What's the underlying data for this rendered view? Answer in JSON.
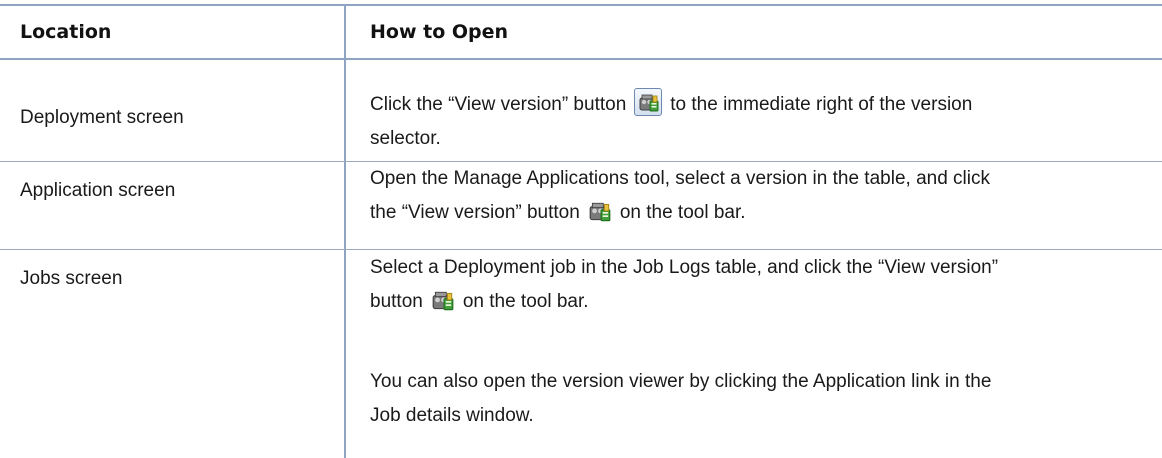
{
  "table": {
    "headers": {
      "location": "Location",
      "how_to_open": "How to Open"
    },
    "rows": [
      {
        "location": "Deployment screen",
        "lines": [
          {
            "before": "Click the “View version” button",
            "icon": "view-version-icon",
            "after": "to the immediate right of the version"
          },
          {
            "text": "selector."
          }
        ]
      },
      {
        "location": "Application screen",
        "lines": [
          {
            "text": "Open the Manage Applications tool, select a version in the table, and click"
          },
          {
            "before": "the “View version” button",
            "icon": "view-version-icon",
            "after": "on the tool bar."
          }
        ]
      },
      {
        "location": "Jobs screen",
        "lines": [
          {
            "text": "Select a Deployment job in the Job Logs table, and click the “View version”"
          },
          {
            "before": "button",
            "icon": "view-version-icon",
            "after": "on the tool bar."
          }
        ],
        "extra_lines": [
          {
            "text": "You can also open the version viewer by clicking the Application link in the"
          },
          {
            "text": "Job details window."
          }
        ]
      }
    ]
  },
  "colors": {
    "rule": "#8ea4c2",
    "text": "#1a1a1a"
  }
}
